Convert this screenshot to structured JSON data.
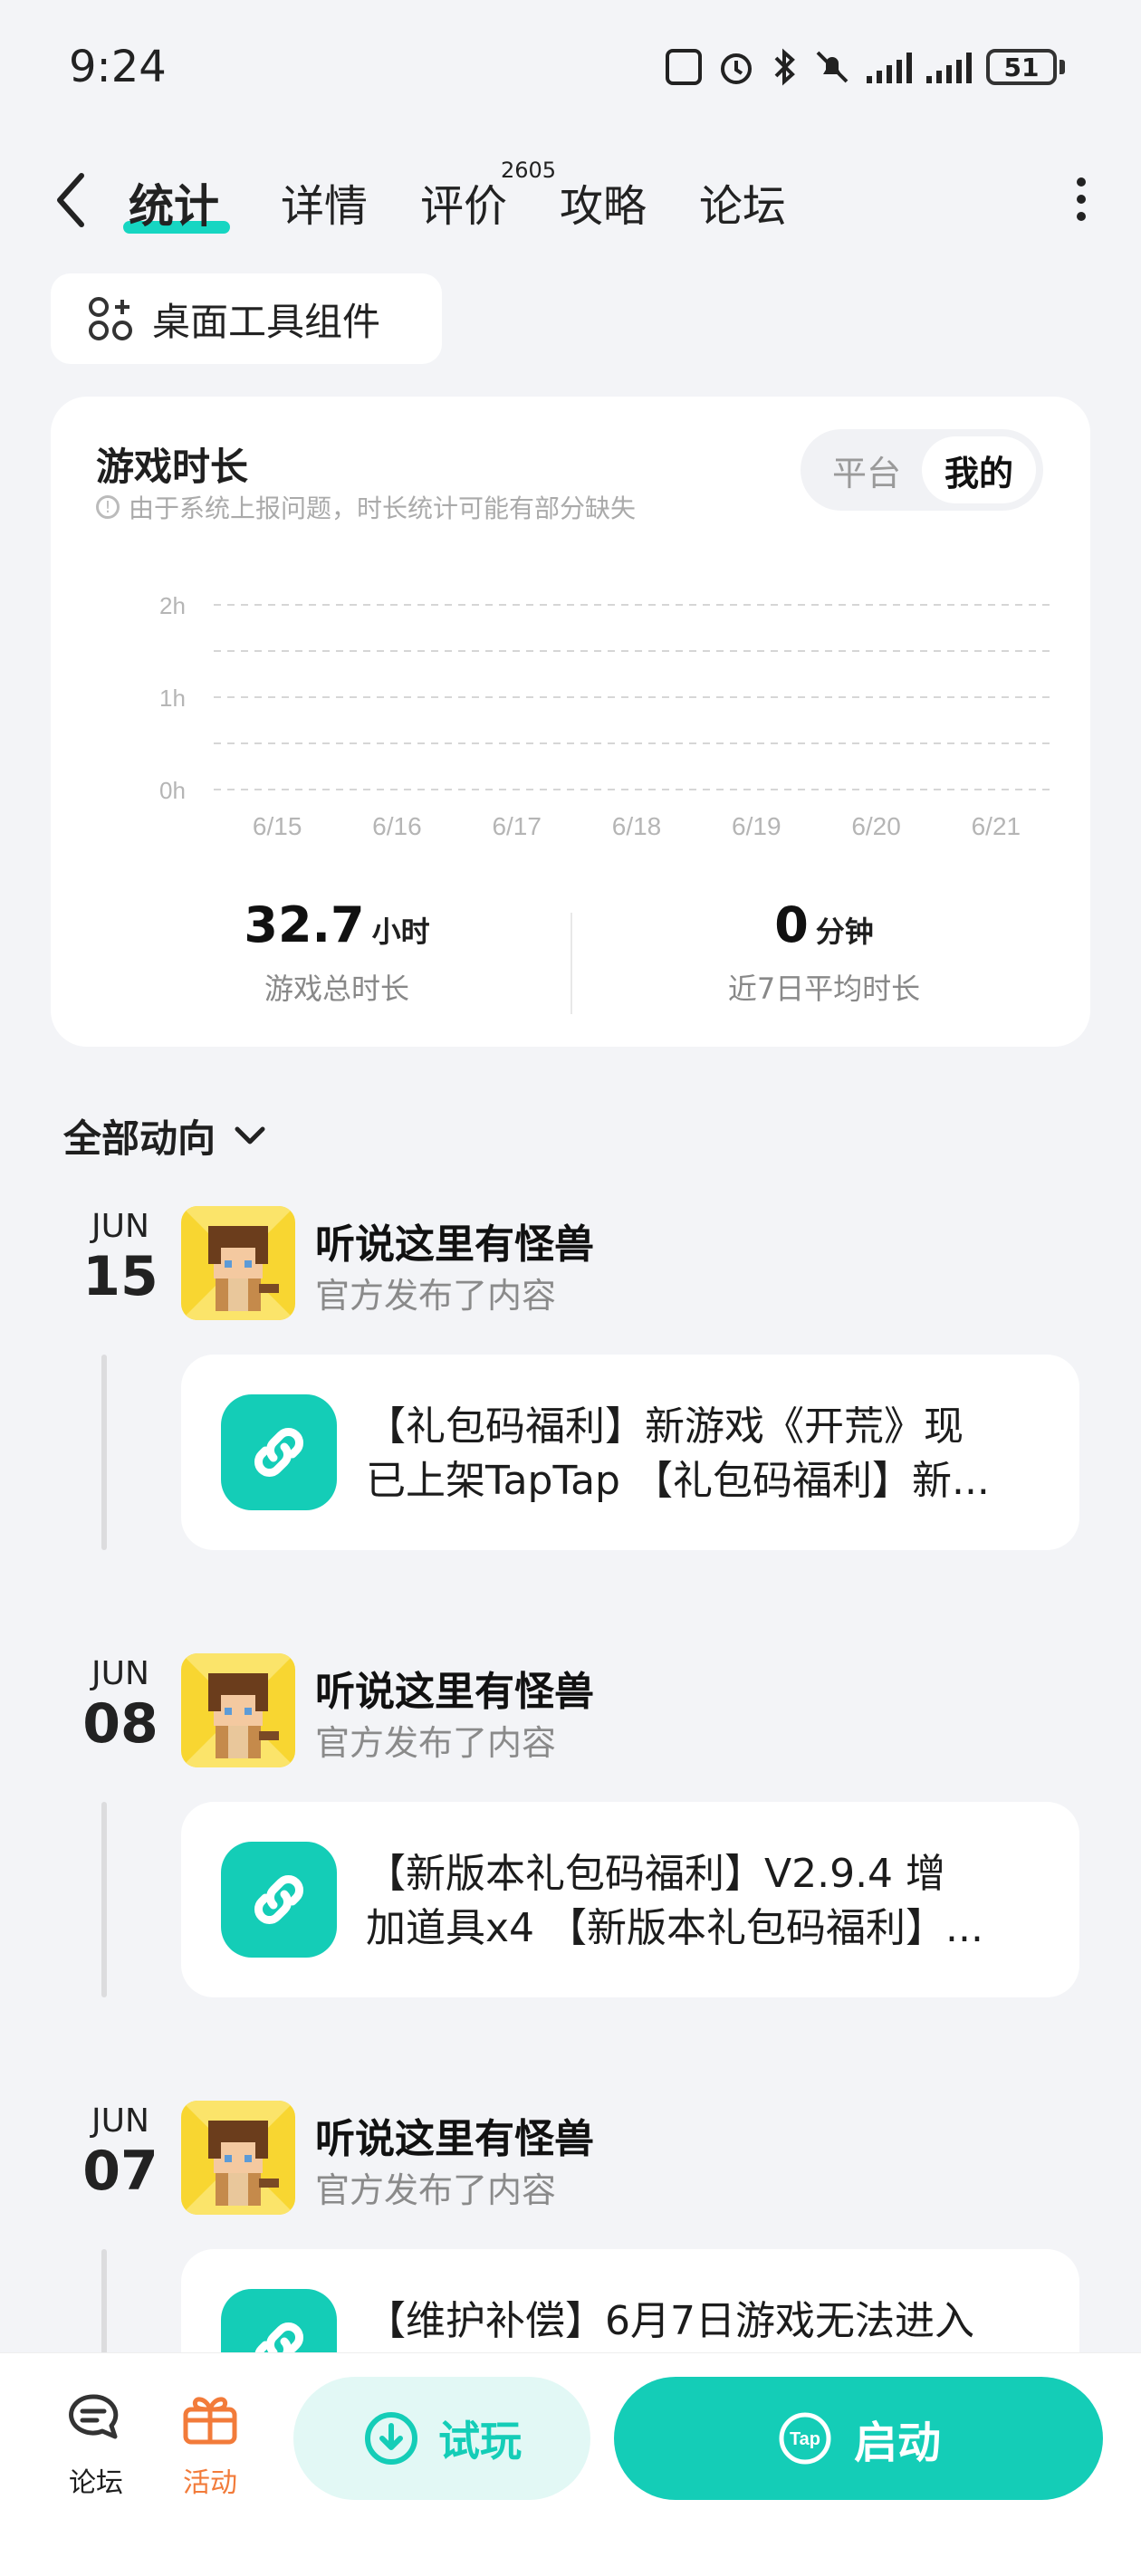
{
  "status_bar": {
    "time": "9:24",
    "battery": "51"
  },
  "nav": {
    "tabs": [
      {
        "label": "统计",
        "active": true
      },
      {
        "label": "详情"
      },
      {
        "label": "评价",
        "badge": "2605"
      },
      {
        "label": "攻略"
      },
      {
        "label": "论坛"
      }
    ]
  },
  "widget_button": {
    "label": "桌面工具组件"
  },
  "stats": {
    "title": "游戏时长",
    "note": "由于系统上报问题，时长统计可能有部分缺失",
    "toggle": {
      "platform": "平台",
      "mine": "我的"
    },
    "total": {
      "value": "32.7",
      "unit": "小时",
      "label": "游戏总时长"
    },
    "avg": {
      "value": "0",
      "unit": "分钟",
      "label": "近7日平均时长"
    }
  },
  "chart_data": {
    "type": "bar",
    "categories": [
      "6/15",
      "6/16",
      "6/17",
      "6/18",
      "6/19",
      "6/20",
      "6/21"
    ],
    "values": [
      0,
      0,
      0,
      0,
      0,
      0,
      0
    ],
    "y_ticks": [
      "0h",
      "1h",
      "2h"
    ],
    "ylim": [
      0,
      2
    ],
    "grid": true
  },
  "feed": {
    "header": "全部动向",
    "posts": [
      {
        "month": "JUN",
        "day": "15",
        "name": "听说这里有怪兽",
        "sub": "官方发布了内容",
        "line1": "【礼包码福利】新游戏《开荒》现",
        "line2": "已上架TapTap 【礼包码福利】新..."
      },
      {
        "month": "JUN",
        "day": "08",
        "name": "听说这里有怪兽",
        "sub": "官方发布了内容",
        "line1": "【新版本礼包码福利】V2.9.4 增",
        "line2": "加道具x4 【新版本礼包码福利】..."
      },
      {
        "month": "JUN",
        "day": "07",
        "name": "听说这里有怪兽",
        "sub": "官方发布了内容",
        "line1": "【维护补偿】6月7日游戏无法进入",
        "line2": ""
      }
    ]
  },
  "bottom_bar": {
    "forum": "论坛",
    "activity": "活动",
    "try": "试玩",
    "launch": "启动",
    "launch_icon_text": "Tap"
  },
  "colors": {
    "accent": "#14cdb7",
    "activity": "#f27b3a"
  }
}
